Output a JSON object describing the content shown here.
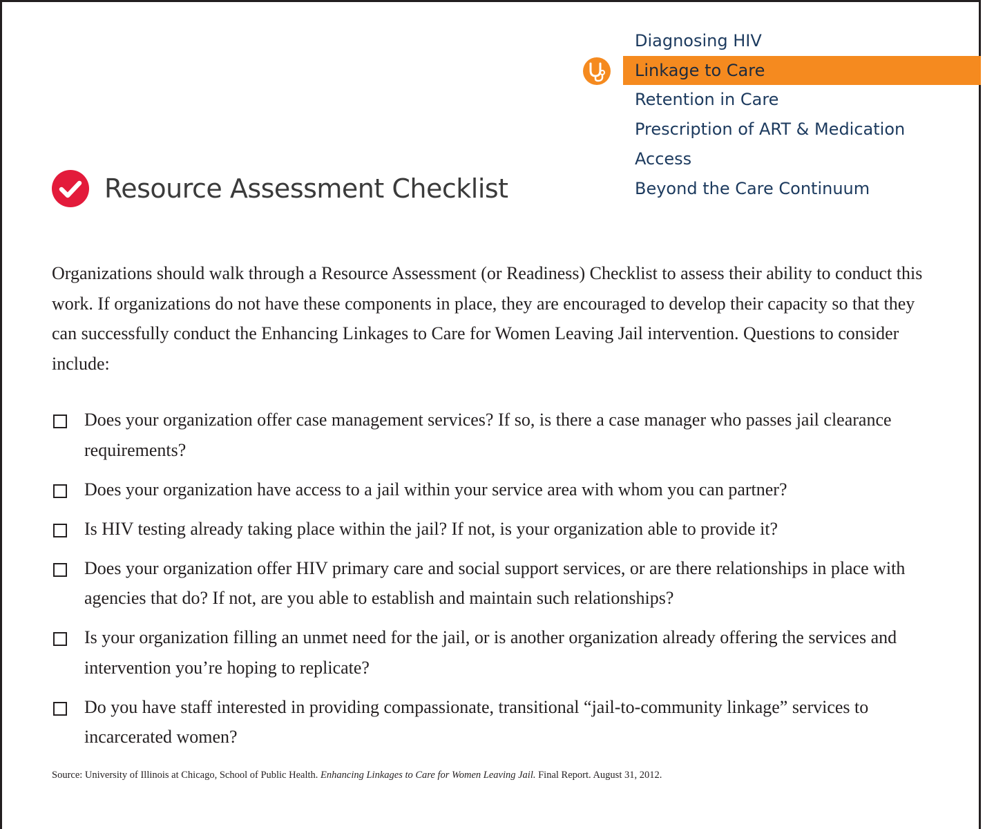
{
  "nav": {
    "items": [
      {
        "label": "Diagnosing HIV",
        "active": false
      },
      {
        "label": "Linkage to Care",
        "active": true
      },
      {
        "label": "Retention in Care",
        "active": false
      },
      {
        "label": "Prescription of ART & Medication",
        "active": false
      },
      {
        "label": "Access",
        "active": false
      },
      {
        "label": "Beyond the Care Continuum",
        "active": false
      }
    ],
    "active_icon": "stethoscope-icon",
    "active_color": "#f58a1f"
  },
  "header": {
    "title": "Resource Assessment Checklist",
    "title_icon": "check-circle-icon",
    "icon_color": "#e31b3b"
  },
  "intro": "Organizations should walk through a Resource Assessment (or Readiness) Checklist to assess their ability to conduct this work. If organizations do not have these components in place, they are encouraged to develop their capacity so that they can successfully conduct the Enhancing Linkages to Care for Women Leaving Jail intervention. Questions to consider include:",
  "checklist": [
    "Does your organization offer case management services? If so, is there a case manager who passes jail clearance requirements?",
    "Does your organization have access to a jail within your service area with whom you can partner?",
    "Is HIV testing already taking place within the jail? If not, is your organization able to provide it?",
    "Does your organization offer HIV primary care and social support services, or are there relationships in place with agencies that do? If not, are you able to establish and maintain such relationships?",
    "Is your organization filling an unmet need for the jail, or is another organization already offering the services and intervention you’re hoping to replicate?",
    "Do you have staff interested in providing compassionate, transitional “jail-to-community linkage” services to incarcerated women?"
  ],
  "source": {
    "prefix": "Source: University of Illinois at Chicago, School of Public Health. ",
    "title": "Enhancing Linkages to Care for Women Leaving Jail.",
    "suffix": " Final Report. August 31, 2012."
  }
}
